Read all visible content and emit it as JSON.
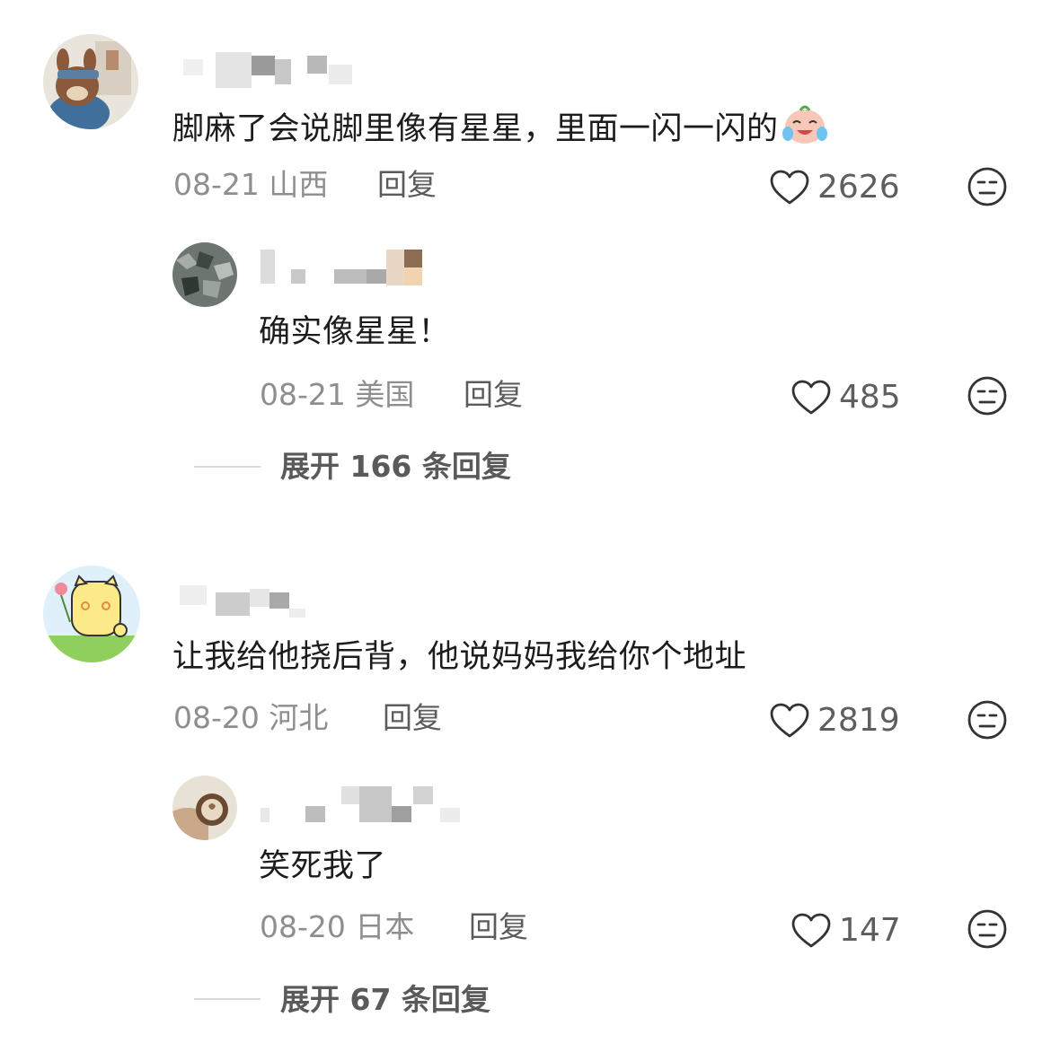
{
  "comments": [
    {
      "text": "脚麻了会说脚里像有星星，里面一闪一闪的",
      "emoji": "crying-laughing-emoji",
      "date": "08-21",
      "location": "山西",
      "reply_label": "回复",
      "likes": "2626",
      "reply": {
        "text": "确实像星星！",
        "date": "08-21",
        "location": "美国",
        "reply_label": "回复",
        "likes": "485"
      },
      "expand_label": "展开 166 条回复"
    },
    {
      "text": "让我给他挠后背，他说妈妈我给你个地址",
      "date": "08-20",
      "location": "河北",
      "reply_label": "回复",
      "likes": "2819",
      "reply": {
        "text": "笑死我了",
        "date": "08-20",
        "location": "日本",
        "reply_label": "回复",
        "likes": "147"
      },
      "expand_label": "展开 67 条回复"
    }
  ],
  "colors": {
    "text": "#1c1c1c",
    "meta": "#8e8e8e",
    "action": "#5b5b5b",
    "divider": "#d9d9d9"
  },
  "icons": [
    "heart-icon",
    "dislike-face-icon",
    "avatar"
  ]
}
